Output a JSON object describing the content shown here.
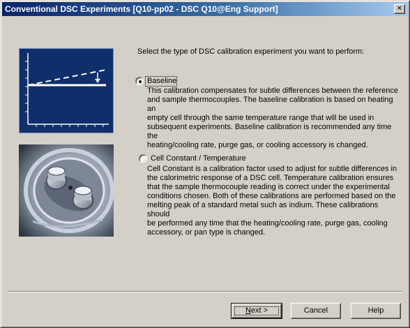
{
  "window": {
    "title": "Conventional DSC Experiments [Q10-pp02 - DSC Q10@Eng Support]",
    "close_glyph": "✕"
  },
  "prompt": "Select the type of DSC calibration experiment you want to perform:",
  "options": [
    {
      "label": "Baseline",
      "selected": true,
      "description_lines": [
        "This calibration compensates for subtle differences between the reference",
        "and sample thermocouples. The baseline calibration is based on heating an",
        "empty cell through the same temperature range that will be used in",
        "subsequent experiments. Baseline calibration is recommended any time the",
        "heating/cooling rate, purge gas, or cooling accessory is changed."
      ]
    },
    {
      "label": "Cell Constant / Temperature",
      "selected": false,
      "description_lines": [
        "Cell Constant is a calibration factor used to adjust for subtle differences in",
        "the calorimetric response of a DSC cell. Temperature calibration ensures",
        "that the sample thermocouple reading is correct under the experimental",
        "conditions chosen. Both of these calibrations are performed based on the",
        "melting peak of a standard metal such as indium. These calibrations should",
        "be performed any time that the heating/cooling rate, purge gas, cooling",
        "accessory, or pan type is changed."
      ]
    }
  ],
  "buttons": {
    "next_prefix": "",
    "next_mnemonic": "N",
    "next_rest": "ext >",
    "cancel": "Cancel",
    "help": "Help"
  },
  "illustrations": {
    "top": "baseline-graph-icon",
    "bottom": "dsc-cell-photo"
  },
  "colors": {
    "face": "#d4d0c8",
    "title_start": "#0a246a",
    "title_end": "#a6caf0",
    "graph_bg": "#0e2f6a"
  }
}
